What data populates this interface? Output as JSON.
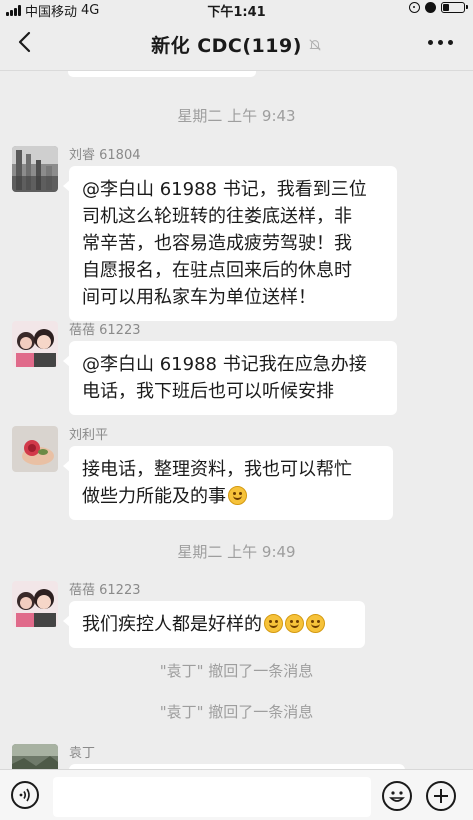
{
  "status_bar": {
    "carrier": "中国移动",
    "network": "4G",
    "time": "下午1:41",
    "icons": [
      "signal-icon",
      "orientation-lock-icon",
      "alarm-icon",
      "battery-icon"
    ],
    "battery_level": 0.3
  },
  "header": {
    "title": "新化 CDC(119)",
    "back_icon": "chevron-left-icon",
    "mute_icon": "bell-muted-icon",
    "more_icon": "more-horizontal-icon"
  },
  "chat": {
    "timestamp_1": "星期二 上午 9:43",
    "timestamp_2": "星期二 上午 9:49",
    "messages": [
      {
        "sender": "刘睿 61804",
        "lines": [
          "@李白山 61988 书记，我看到三位",
          "司机这么轮班转的往娄底送样，非",
          "常辛苦，也容易造成疲劳驾驶！我",
          "自愿报名，在驻点回来后的休息时",
          "间可以用私家车为单位送样！"
        ]
      },
      {
        "sender": "蓓蓓 61223",
        "lines": [
          "@李白山 61988 书记我在应急办接",
          "电话，我下班后也可以听候安排"
        ]
      },
      {
        "sender": "刘利平",
        "lines": [
          "接电话，整理资料，我也可以帮忙",
          "做些力所能及的事"
        ],
        "emoji_count": 1
      },
      {
        "sender": "蓓蓓 61223",
        "lines": [
          "我们疾控人都是好样的"
        ],
        "emoji_count": 3
      },
      {
        "sender": "袁丁",
        "lines": []
      }
    ],
    "recall_notices": [
      "\"袁丁\" 撤回了一条消息",
      "\"袁丁\" 撤回了一条消息"
    ]
  },
  "input_bar": {
    "voice_icon": "voice-icon",
    "emoji_icon": "emoji-icon",
    "plus_icon": "plus-icon",
    "text_value": ""
  },
  "colors": {
    "background": "#ededed",
    "bubble": "#ffffff",
    "system_text": "#9e9e9e",
    "sender_text": "#8a8a8a"
  }
}
